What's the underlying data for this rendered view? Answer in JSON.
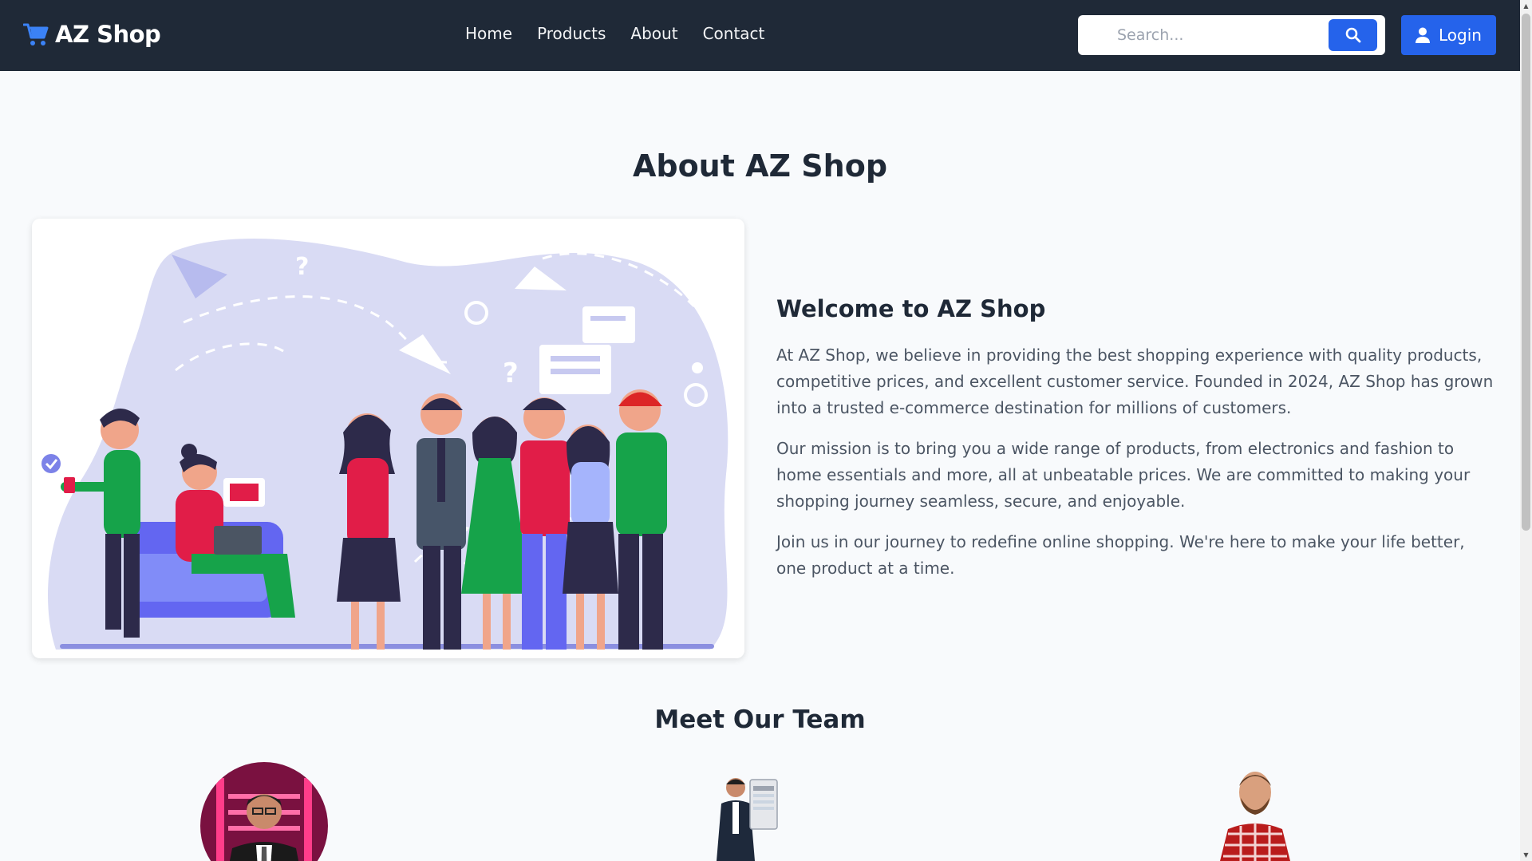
{
  "navbar": {
    "brand": "AZ Shop",
    "links": [
      "Home",
      "Products",
      "About",
      "Contact"
    ],
    "search_placeholder": "Search...",
    "login_label": "Login"
  },
  "about": {
    "title": "About AZ Shop",
    "welcome_title": "Welcome to AZ Shop",
    "paragraphs": [
      "At AZ Shop, we believe in providing the best shopping experience with quality products, competitive prices, and excellent customer service. Founded in 2024, AZ Shop has grown into a trusted e-commerce destination for millions of customers.",
      "Our mission is to bring you a wide range of products, from electronics and fashion to home essentials and more, all at unbeatable prices. We are committed to making your shopping journey seamless, secure, and enjoyable.",
      "Join us in our journey to redefine online shopping. We're here to make your life better, one product at a time."
    ]
  },
  "team": {
    "title": "Meet Our Team"
  },
  "colors": {
    "navbar_bg": "#1f2937",
    "accent": "#2563eb",
    "page_bg": "#f8fafc"
  },
  "icons": [
    "cart-icon",
    "search-icon",
    "user-icon"
  ]
}
